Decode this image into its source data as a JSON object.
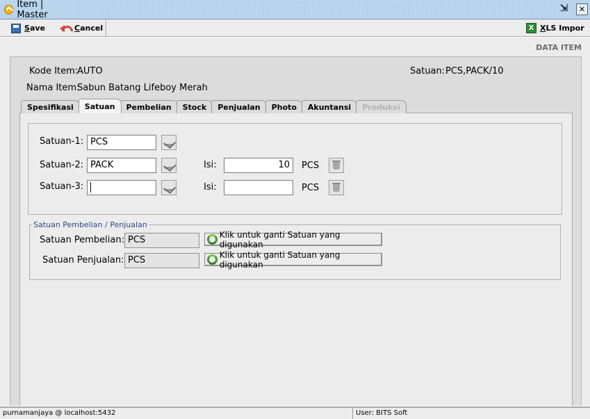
{
  "window": {
    "title": "Item | Master"
  },
  "toolbar": {
    "save": "Save",
    "cancel": "Cancel",
    "xls_import": "XLS Impor"
  },
  "header": {
    "section_label": "DATA ITEM"
  },
  "item": {
    "kode_label": "Kode Item:",
    "kode_value": "AUTO",
    "nama_label": "Nama Item:",
    "nama_value": "Sabun Batang Lifeboy Merah",
    "satuan_label": "Satuan:",
    "satuan_value": "PCS,PACK/10"
  },
  "tabs": [
    {
      "label": "Spesifikasi",
      "active": false,
      "disabled": false
    },
    {
      "label": "Satuan",
      "active": true,
      "disabled": false
    },
    {
      "label": "Pembelian",
      "active": false,
      "disabled": false
    },
    {
      "label": "Stock",
      "active": false,
      "disabled": false
    },
    {
      "label": "Penjualan",
      "active": false,
      "disabled": false
    },
    {
      "label": "Photo",
      "active": false,
      "disabled": false
    },
    {
      "label": "Akuntansi",
      "active": false,
      "disabled": false
    },
    {
      "label": "Produksi",
      "active": false,
      "disabled": true
    }
  ],
  "satuan": {
    "satuan1_label": "Satuan-1:",
    "satuan1_value": "PCS",
    "satuan2_label": "Satuan-2:",
    "satuan2_value": "PACK",
    "satuan3_label": "Satuan-3:",
    "satuan3_value": "",
    "isi_label": "Isi:",
    "isi2_value": "10",
    "isi2_unit": "PCS",
    "isi3_value": "",
    "isi3_unit": "PCS"
  },
  "pembelian_penjualan": {
    "group_title": "Satuan Pembelian / Penjualan",
    "pembelian_label": "Satuan Pembelian:",
    "pembelian_value": "PCS",
    "penjualan_label": "Satuan Penjualan:",
    "penjualan_value": "PCS",
    "change_button_label": "Klik untuk ganti Satuan yang digunakan"
  },
  "status": {
    "connection": "purnamanjaya @ localhost:5432",
    "user": "User: BITS Soft"
  }
}
